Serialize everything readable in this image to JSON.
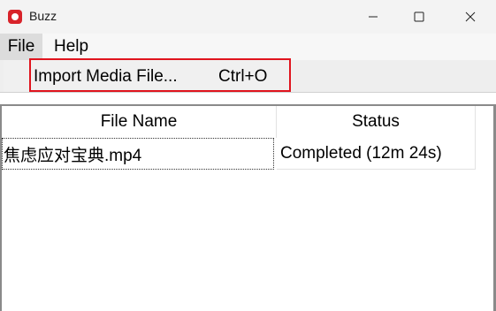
{
  "window": {
    "title": "Buzz"
  },
  "menubar": {
    "items": [
      {
        "label": "File"
      },
      {
        "label": "Help"
      }
    ]
  },
  "file_menu": {
    "items": [
      {
        "label": "Import Media File...",
        "shortcut": "Ctrl+O"
      }
    ]
  },
  "table": {
    "columns": [
      "File Name",
      "Status"
    ],
    "rows": [
      {
        "file_name": "焦虑应对宝典.mp4",
        "status": "Completed (12m 24s)"
      }
    ]
  },
  "colors": {
    "accent": "#e0141e",
    "app_icon": "#d8232a"
  }
}
